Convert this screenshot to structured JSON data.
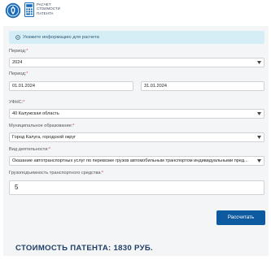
{
  "header": {
    "app_logo_lines": [
      "РАСЧЕТ",
      "СТОИМОСТИ",
      "ПАТЕНТА"
    ]
  },
  "info": {
    "text": "Укажите информацию для расчета"
  },
  "form": {
    "required_mark": "*",
    "period_label": "Период:",
    "period_value": "2024",
    "dates_label": "Период:",
    "date_from": "01.01.2024",
    "date_to": "31.01.2024",
    "ufns_label": "УФНС:",
    "ufns_value": "40 Калужская область",
    "municipality_label": "Муниципальное образование:",
    "municipality_value": "Город Калуга, городской округ",
    "activity_label": "Вид деятельности:",
    "activity_value": "Оказание автотранспортных услуг по перевозке грузов автомобильным транспортом индивидуальными пред...",
    "capacity_label": "Грузоподъемность транспортного средства:",
    "capacity_value": "5",
    "calc_button": "Рассчитать"
  },
  "result": {
    "text": "СТОИМОСТЬ ПАТЕНТА: 1830 РУБ."
  },
  "colors": {
    "primary": "#0d5aa0",
    "info_bg": "#d5edf5",
    "result_text": "#1f3f66"
  }
}
